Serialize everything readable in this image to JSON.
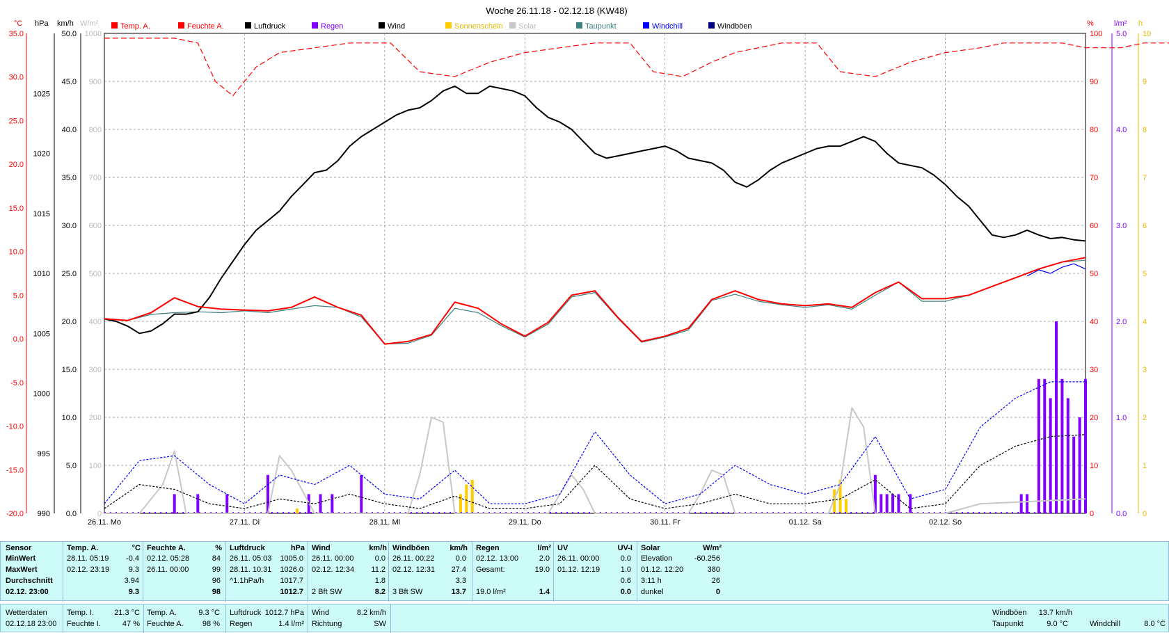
{
  "chart_data": {
    "type": "line",
    "title": "Woche 26.11.18 - 02.12.18 (KW48)",
    "legend": [
      "Temp. A.",
      "Feuchte A.",
      "Luftdruck",
      "Regen",
      "Wind",
      "Sonnenschein",
      "Solar",
      "Taupunkt",
      "Windchill",
      "Windböen"
    ],
    "legend_colors": [
      "#ff0000",
      "#ff0000",
      "#000000",
      "#8000ff",
      "#000000",
      "#ffcc00",
      "#c8c8c8",
      "#408080",
      "#0000ff",
      "#000080"
    ],
    "axis_units": {
      "temp": "°C",
      "pressure": "hPa",
      "wind": "km/h",
      "solar": "W/m²",
      "humidity": "%",
      "rain": "l/m²",
      "sun": "h"
    },
    "temp_ticks": [
      "35.0",
      "30.0",
      "25.0",
      "20.0",
      "15.0",
      "10.0",
      "5.0",
      "0.0",
      "-5.0",
      "-10.0",
      "-15.0",
      "-20.0"
    ],
    "pressure_ticks": [
      "1025",
      "1020",
      "1015",
      "1010",
      "1005",
      "1000",
      "995",
      "990"
    ],
    "wind_ticks": [
      "50.0",
      "45.0",
      "40.0",
      "35.0",
      "30.0",
      "25.0",
      "20.0",
      "15.0",
      "10.0",
      "5.0",
      "0.0"
    ],
    "solar_ticks": [
      "1000",
      "900",
      "800",
      "700",
      "600",
      "500",
      "400",
      "300",
      "200",
      "100",
      "0"
    ],
    "humidity_ticks": [
      "100",
      "90",
      "80",
      "70",
      "60",
      "50",
      "40",
      "30",
      "20",
      "10",
      "0"
    ],
    "rain_ticks": [
      "5.0",
      "4.0",
      "3.0",
      "2.0",
      "1.0",
      "0.0"
    ],
    "sun_ticks": [
      "10",
      "9",
      "8",
      "7",
      "6",
      "5",
      "4",
      "3",
      "2",
      "1",
      "0"
    ],
    "day_labels": [
      "26.11. Mo",
      "27.11. Di",
      "28.11. Mi",
      "29.11. Do",
      "30.11. Fr",
      "01.12. Sa",
      "02.12. So"
    ],
    "x_range_hours": [
      0,
      168
    ],
    "series": [
      {
        "name": "Feuchte A.",
        "axis": "humidity",
        "style": "dashed",
        "color": "#ff0000",
        "x": [
          0,
          6,
          12,
          16,
          19,
          22,
          26,
          30,
          36,
          42,
          46,
          49,
          54,
          60,
          66,
          72,
          78,
          84,
          88,
          90,
          94,
          99,
          104,
          108,
          112,
          116,
          118,
          122,
          126,
          132,
          138,
          144,
          150,
          154,
          156,
          160,
          164,
          168,
          170,
          174,
          178,
          182,
          184,
          186,
          190,
          196,
          200,
          204,
          212,
          222,
          232,
          246
        ],
        "y": [
          99,
          99,
          99,
          98,
          90,
          87,
          93,
          96,
          97,
          98,
          98,
          98,
          92,
          91,
          94,
          96,
          97,
          98,
          98,
          98,
          92,
          91,
          94,
          96,
          97,
          98,
          98,
          98,
          92,
          91,
          94,
          96,
          97,
          98,
          98,
          98,
          98,
          97,
          97,
          97,
          98,
          98,
          98,
          98,
          98,
          93,
          87,
          91,
          96,
          97,
          98,
          99
        ]
      },
      {
        "name": "Luftdruck",
        "axis": "pressure",
        "style": "solid",
        "color": "#000000",
        "x": [
          0,
          2,
          4,
          6,
          8,
          10,
          12,
          14,
          16,
          18,
          20,
          22,
          24,
          26,
          28,
          30,
          32,
          34,
          36,
          38,
          40,
          42,
          44,
          46,
          48,
          50,
          52,
          54,
          56,
          58,
          60,
          62,
          64,
          66,
          68,
          70,
          72,
          74,
          76,
          78,
          80,
          82,
          84,
          86,
          88,
          90,
          92,
          94,
          96,
          98,
          100,
          102,
          104,
          106,
          108,
          110,
          112,
          114,
          116,
          118,
          120,
          122,
          124,
          126,
          128,
          130,
          132,
          134,
          136,
          138,
          140,
          142,
          144,
          146,
          148,
          150,
          152,
          154,
          156,
          158,
          160,
          162,
          164,
          166,
          168
        ],
        "y": [
          1006.2,
          1006.0,
          1005.6,
          1005.0,
          1005.2,
          1005.8,
          1006.6,
          1006.6,
          1006.8,
          1008.0,
          1009.6,
          1011.0,
          1012.4,
          1013.6,
          1014.4,
          1015.2,
          1016.4,
          1017.4,
          1018.4,
          1018.6,
          1019.4,
          1020.6,
          1021.4,
          1022.0,
          1022.6,
          1023.2,
          1023.6,
          1023.8,
          1024.4,
          1025.2,
          1025.6,
          1025.0,
          1025.0,
          1025.6,
          1025.4,
          1025.2,
          1024.8,
          1023.8,
          1023.0,
          1022.6,
          1022.0,
          1021.0,
          1020.0,
          1019.6,
          1019.8,
          1020.0,
          1020.2,
          1020.4,
          1020.6,
          1020.2,
          1019.6,
          1019.4,
          1019.2,
          1018.6,
          1017.6,
          1017.2,
          1017.8,
          1018.6,
          1019.2,
          1019.6,
          1020.0,
          1020.4,
          1020.6,
          1020.6,
          1021.0,
          1021.4,
          1021.0,
          1020.0,
          1019.2,
          1019.0,
          1018.8,
          1018.2,
          1017.4,
          1016.4,
          1015.6,
          1014.4,
          1013.2,
          1013.0,
          1013.2,
          1013.6,
          1013.2,
          1012.9,
          1013.0,
          1012.8,
          1012.7
        ]
      },
      {
        "name": "Temp. A.",
        "axis": "temp",
        "style": "solid",
        "color": "#ff0000",
        "x": [
          0,
          4,
          8,
          12,
          16,
          20,
          24,
          28,
          32,
          36,
          40,
          44,
          48,
          52,
          56,
          60,
          64,
          68,
          72,
          76,
          80,
          84,
          88,
          92,
          96,
          100,
          104,
          108,
          112,
          116,
          120,
          124,
          128,
          132,
          136,
          140,
          144,
          148,
          152,
          156,
          160,
          164,
          168
        ],
        "y": [
          2.3,
          2.1,
          3.0,
          4.7,
          3.7,
          3.4,
          3.3,
          3.2,
          3.6,
          4.8,
          3.6,
          2.7,
          -0.6,
          -0.3,
          0.5,
          4.2,
          3.5,
          1.7,
          0.3,
          1.9,
          5.0,
          5.5,
          2.4,
          -0.3,
          0.3,
          1.2,
          4.5,
          5.5,
          4.5,
          4.0,
          3.8,
          4.0,
          3.6,
          5.3,
          6.5,
          4.6,
          4.6,
          5.0,
          6.0,
          7.0,
          8.0,
          8.8,
          9.3
        ]
      },
      {
        "name": "Taupunkt",
        "axis": "temp",
        "style": "solid",
        "color": "#408080",
        "x": [
          0,
          4,
          8,
          12,
          16,
          20,
          24,
          28,
          32,
          36,
          40,
          44,
          48,
          52,
          56,
          60,
          64,
          68,
          72,
          76,
          80,
          84,
          88,
          92,
          96,
          100,
          104,
          108,
          112,
          116,
          120,
          124,
          128,
          132,
          136,
          140,
          144,
          148,
          152,
          156,
          160,
          164,
          168
        ],
        "y": [
          2.3,
          2.1,
          2.8,
          3.0,
          3.1,
          3.0,
          3.2,
          3.0,
          3.4,
          3.8,
          3.6,
          2.5,
          -0.6,
          -0.5,
          0.4,
          3.5,
          3.0,
          1.5,
          0.2,
          1.7,
          4.8,
          5.3,
          2.3,
          -0.4,
          0.2,
          1.0,
          4.4,
          5.1,
          4.3,
          3.9,
          3.6,
          3.9,
          3.4,
          5.0,
          6.5,
          4.3,
          4.3,
          5.0,
          6.0,
          7.0,
          8.0,
          8.8,
          9.0
        ]
      },
      {
        "name": "Windchill",
        "axis": "temp",
        "style": "solid",
        "color": "#0000ff",
        "x": [
          158,
          160,
          162,
          164,
          166,
          168
        ],
        "y": [
          7.2,
          7.9,
          7.5,
          8.2,
          8.6,
          8.0
        ]
      },
      {
        "name": "Wind",
        "axis": "wind",
        "style": "dashed",
        "color": "#000000",
        "x": [
          0,
          6,
          12,
          18,
          24,
          30,
          36,
          42,
          48,
          54,
          60,
          66,
          72,
          78,
          84,
          90,
          96,
          102,
          108,
          114,
          120,
          126,
          132,
          138,
          144,
          150,
          156,
          162,
          168
        ],
        "y": [
          0.5,
          3.0,
          2.5,
          1.0,
          0.5,
          1.5,
          1.0,
          2.0,
          1.0,
          0.5,
          1.8,
          0.5,
          0.5,
          1.0,
          5.0,
          1.5,
          0.5,
          1.0,
          2.0,
          1.0,
          1.0,
          1.5,
          3.5,
          0.5,
          1.0,
          5.0,
          7.0,
          8.0,
          8.2
        ]
      },
      {
        "name": "Windböen",
        "axis": "wind",
        "style": "dashed",
        "color": "#0000ff",
        "x": [
          0,
          6,
          12,
          18,
          24,
          30,
          36,
          42,
          48,
          54,
          60,
          66,
          72,
          78,
          84,
          90,
          96,
          102,
          108,
          114,
          120,
          126,
          132,
          138,
          144,
          150,
          156,
          162,
          168
        ],
        "y": [
          1.0,
          5.5,
          6.0,
          3.0,
          1.0,
          4.0,
          3.0,
          5.0,
          2.0,
          1.5,
          4.5,
          1.0,
          1.0,
          2.0,
          8.5,
          4.0,
          1.0,
          2.0,
          5.0,
          3.0,
          2.0,
          3.0,
          8.0,
          1.5,
          2.5,
          9.0,
          12.0,
          13.7,
          13.7
        ]
      },
      {
        "name": "Solar",
        "axis": "solar",
        "style": "solid",
        "color": "#c8c8c8",
        "x": [
          0,
          6,
          10,
          12,
          14,
          18,
          28,
          30,
          32,
          36,
          52,
          54,
          56,
          58,
          60,
          76,
          78,
          80,
          82,
          84,
          88,
          100,
          102,
          104,
          106,
          108,
          124,
          126,
          128,
          130,
          132,
          134,
          144,
          150,
          168
        ],
        "y": [
          0,
          0,
          60,
          130,
          0,
          0,
          0,
          120,
          90,
          0,
          0,
          80,
          200,
          190,
          0,
          0,
          40,
          80,
          50,
          0,
          0,
          0,
          40,
          90,
          80,
          0,
          0,
          60,
          220,
          180,
          0,
          0,
          0,
          20,
          30
        ]
      }
    ],
    "bars": [
      {
        "name": "Regen",
        "axis": "rain",
        "color": "#8000ff",
        "x": [
          12,
          16,
          21,
          28,
          35,
          37,
          39,
          44,
          132,
          133,
          134,
          135,
          136,
          138,
          157,
          158,
          160,
          161,
          162,
          163,
          164,
          165,
          166,
          167,
          168
        ],
        "y": [
          0.2,
          0.2,
          0.2,
          0.4,
          0.2,
          0.2,
          0.2,
          0.4,
          0.4,
          0.2,
          0.2,
          0.2,
          0.2,
          0.2,
          0.2,
          0.2,
          1.4,
          1.4,
          1.2,
          2.0,
          1.4,
          1.2,
          0.8,
          1.0,
          1.4
        ]
      },
      {
        "name": "Sonnenschein",
        "axis": "sun",
        "color": "#ffcc00",
        "x": [
          33,
          61,
          62,
          63,
          125,
          126,
          127
        ],
        "y": [
          0.1,
          0.4,
          0.6,
          0.7,
          0.5,
          0.7,
          0.3
        ]
      }
    ]
  },
  "stats_table": {
    "headers": [
      {
        "name": "Sensor",
        "unit": ""
      },
      {
        "name": "Temp. A.",
        "unit": "°C"
      },
      {
        "name": "Feuchte A.",
        "unit": "%"
      },
      {
        "name": "Luftdruck",
        "unit": "hPa"
      },
      {
        "name": "Wind",
        "unit": "km/h"
      },
      {
        "name": "Windböen",
        "unit": "km/h"
      },
      {
        "name": "Regen",
        "unit": "l/m²"
      },
      {
        "name": "UV",
        "unit": "UV-I"
      },
      {
        "name": "Solar",
        "unit": "W/m²"
      }
    ],
    "rows": [
      {
        "label": "MinWert",
        "cells": [
          [
            "28.11.  05:19",
            "-0.4"
          ],
          [
            "02.12.  05:28",
            "84"
          ],
          [
            "26.11.  05:03",
            "1005.0"
          ],
          [
            "26.11.  00:00",
            "0.0"
          ],
          [
            "26.11.  00:22",
            "0.0"
          ],
          [
            "02.12.  13:00",
            "2.0"
          ],
          [
            "26.11.  00:00",
            "0.0"
          ],
          [
            "Elevation",
            "-60.256"
          ]
        ]
      },
      {
        "label": "MaxWert",
        "cells": [
          [
            "02.12.  23:19",
            "9.3"
          ],
          [
            "26.11.  00:00",
            "99"
          ],
          [
            "28.11.  10:31",
            "1026.0"
          ],
          [
            "02.12.  12:34",
            "11.2"
          ],
          [
            "02.12.  12:31",
            "27.4"
          ],
          [
            "Gesamt:",
            "19.0"
          ],
          [
            "01.12.  12:19",
            "1.0"
          ],
          [
            "01.12.  12:20",
            "380"
          ]
        ]
      },
      {
        "label": "Durchschnitt",
        "cells": [
          [
            "",
            "3.94"
          ],
          [
            "",
            "96"
          ],
          [
            "^1.1hPa/h",
            "1017.7"
          ],
          [
            "",
            "1.8"
          ],
          [
            "",
            "3.3"
          ],
          [
            "",
            ""
          ],
          [
            "",
            "0.6"
          ],
          [
            "3:11 h",
            "26"
          ]
        ]
      },
      {
        "label": "02.12. 23:00",
        "cells": [
          [
            "",
            "9.3"
          ],
          [
            "",
            "98"
          ],
          [
            "",
            "1012.7"
          ],
          [
            "2 Bft SW",
            "8.2"
          ],
          [
            "3 Bft SW",
            "13.7"
          ],
          [
            "19.0 l/m²",
            "1.4"
          ],
          [
            "",
            "0.0"
          ],
          [
            "dunkel",
            "0"
          ]
        ]
      }
    ]
  },
  "status_bar": {
    "weather_label": "Wetterdaten",
    "timestamp": "02.12.18 23:00",
    "temp_i_label": "Temp. I.",
    "temp_i_value": "21.3 °C",
    "feuchte_i_label": "Feuchte I.",
    "feuchte_i_value": "47 %",
    "temp_a_label": "Temp. A.",
    "temp_a_value": "9.3 °C",
    "feuchte_a_label": "Feuchte A.",
    "feuchte_a_value": "98 %",
    "luftdruck_label": "Luftdruck",
    "luftdruck_value": "1012.7 hPa",
    "regen_label": "Regen",
    "regen_value": "1.4 l/m²",
    "wind_label": "Wind",
    "wind_value": "8.2 km/h",
    "richtung_label": "Richtung",
    "richtung_value": "SW",
    "windboeen_label": "Windböen",
    "windboeen_value": "13.7 km/h",
    "taupunkt_label": "Taupunkt",
    "taupunkt_value": "9.0 °C",
    "windchill_label": "Windchill",
    "windchill_value": "8.0 °C"
  }
}
